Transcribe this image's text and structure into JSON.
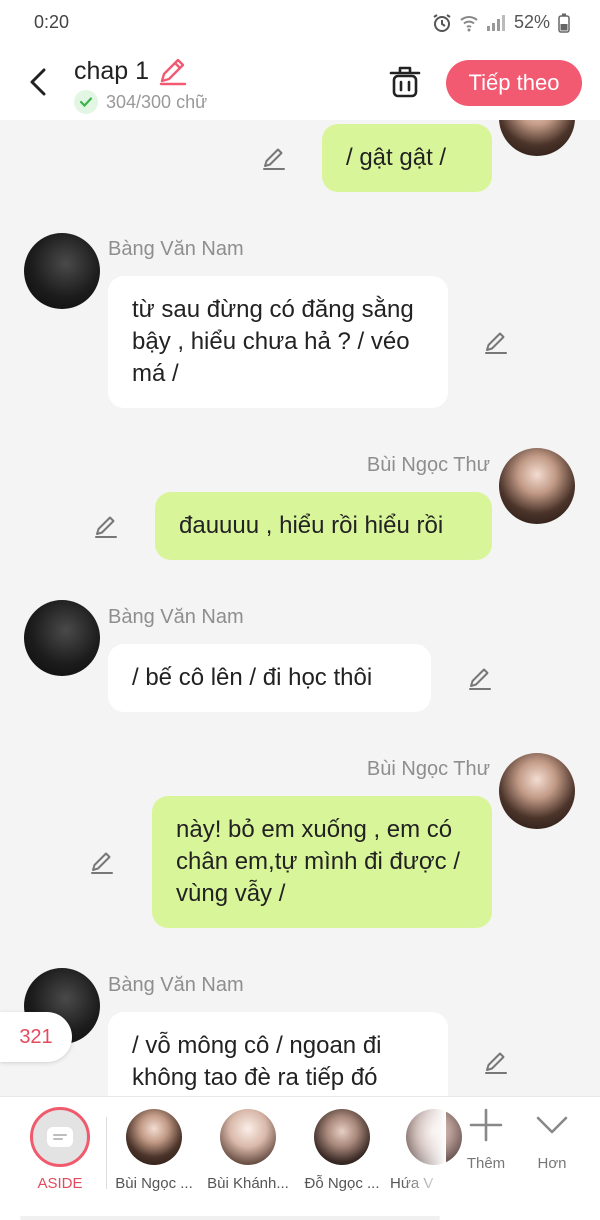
{
  "status_bar": {
    "time": "0:20",
    "battery": "52%"
  },
  "header": {
    "title": "chap 1",
    "word_count": "304/300 chữ",
    "next_label": "Tiếp theo",
    "accent_color": "#f25a72"
  },
  "messages": [
    {
      "side": "right",
      "sender": "",
      "text": "/ gật gật /"
    },
    {
      "side": "left",
      "sender": "Bàng Văn Nam",
      "text": "từ sau đừng có đăng sằng bậy , hiểu chưa hả ? / véo má /"
    },
    {
      "side": "right",
      "sender": "Bùi Ngọc Thư",
      "text": "đauuuu , hiểu rồi hiểu rồi"
    },
    {
      "side": "left",
      "sender": "Bàng Văn Nam",
      "text": "/ bế cô lên / đi học thôi"
    },
    {
      "side": "right",
      "sender": "Bùi Ngọc Thư",
      "text": "này! bỏ em xuống , em có chân em,tự mình đi được / vùng vẫy /"
    },
    {
      "side": "left",
      "sender": "Bàng Văn Nam",
      "text": "/ vỗ mông cô / ngoan đi không tao đè ra tiếp đó"
    }
  ],
  "floating_count": "321",
  "bottom_bar": {
    "aside_label": "ASIDE",
    "characters": [
      {
        "name": "Bùi Ngọc ..."
      },
      {
        "name": "Bùi Khánh..."
      },
      {
        "name": "Đỗ Ngọc ..."
      },
      {
        "name": "Hứa V"
      }
    ],
    "add_label": "Thêm",
    "more_label": "Hơn"
  }
}
